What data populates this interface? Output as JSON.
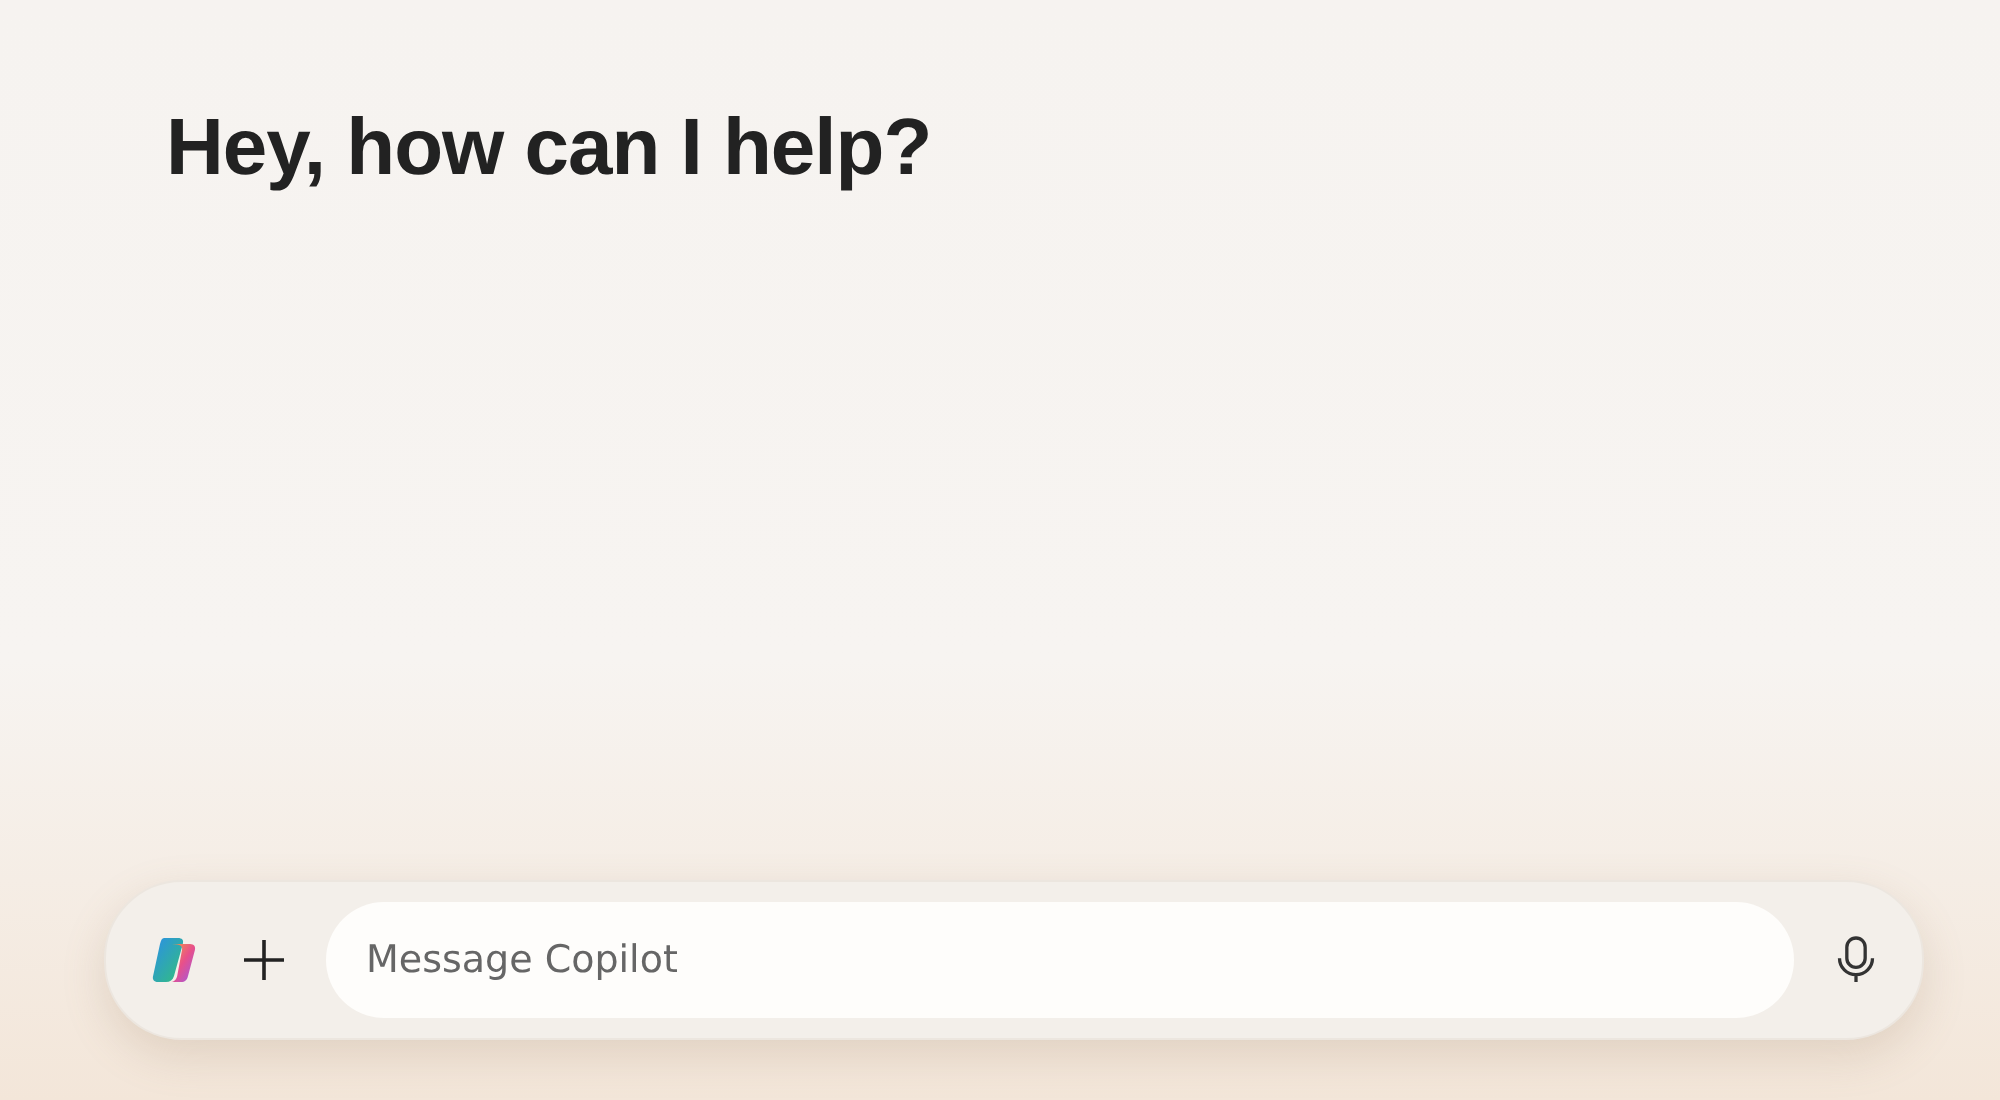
{
  "greeting": "Hey, how can I help?",
  "composer": {
    "placeholder": "Message Copilot"
  }
}
